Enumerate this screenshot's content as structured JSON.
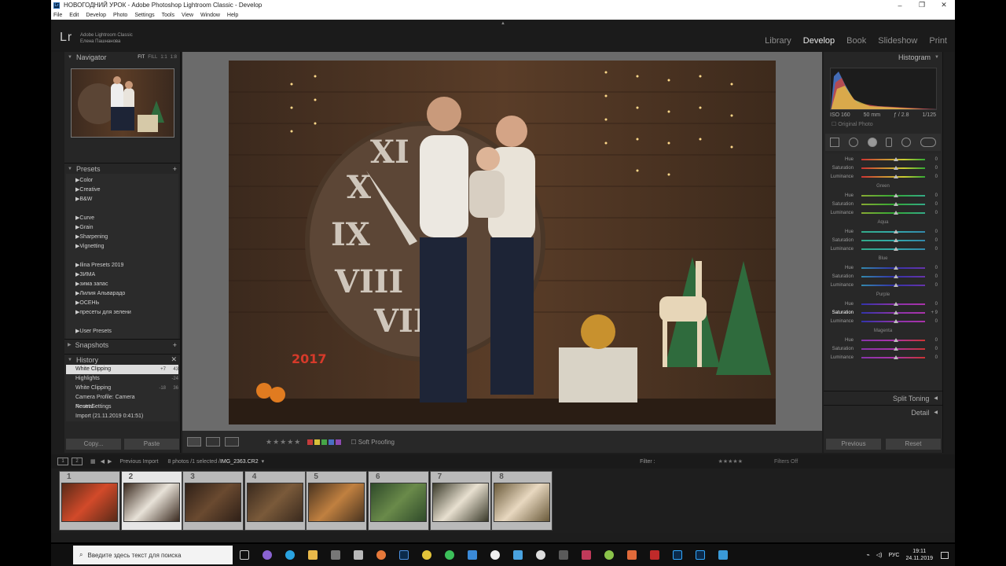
{
  "window": {
    "title": "НОВОГОДНИЙ УРОК - Adobe Photoshop Lightroom Classic - Develop",
    "lr_badge": "Lr"
  },
  "menu": [
    "File",
    "Edit",
    "Develop",
    "Photo",
    "Settings",
    "Tools",
    "View",
    "Window",
    "Help"
  ],
  "identity": {
    "logo": "Lr",
    "app": "Adobe Lightroom Classic",
    "user": "Елена Пашнанова"
  },
  "modules": [
    "Library",
    "Develop",
    "Book",
    "Slideshow",
    "Print"
  ],
  "active_module": "Develop",
  "navigator": {
    "label": "Navigator",
    "zoom": [
      "FIT",
      "FILL",
      "1:1",
      "1:8"
    ]
  },
  "presets": {
    "label": "Presets",
    "groups": [
      [
        "Color",
        "Creative",
        "B&W"
      ],
      [
        "Curve",
        "Grain",
        "Sharpening",
        "Vignetting"
      ],
      [
        "Ilina Presets 2019",
        "ЗИМА",
        "зима запас",
        "Лилия Альварадо",
        "ОСЕНЬ",
        "пресеты для зелени"
      ],
      [
        "User Presets"
      ]
    ]
  },
  "snapshots": {
    "label": "Snapshots"
  },
  "history": {
    "label": "History",
    "items": [
      {
        "name": "White Clipping",
        "a": "+7",
        "b": "43",
        "selected": true
      },
      {
        "name": "Highlights",
        "a": "",
        "b": "-24",
        "selected": false
      },
      {
        "name": "White Clipping",
        "a": "-18",
        "b": "36",
        "selected": false
      },
      {
        "name": "Camera Profile: Camera Neutral",
        "a": "",
        "b": "",
        "selected": false
      },
      {
        "name": "Reset Settings",
        "a": "",
        "b": "",
        "selected": false
      },
      {
        "name": "Import (21.11.2019 0:41:51)",
        "a": "",
        "b": "",
        "selected": false
      }
    ]
  },
  "left_buttons": {
    "copy": "Copy...",
    "paste": "Paste"
  },
  "toolbar": {
    "soft_proofing": "Soft Proofing",
    "stars": "★★★★★"
  },
  "swatch_colors": [
    "#c43b3b",
    "#d8c13a",
    "#46a547",
    "#4a6fc3",
    "#8e4ab2"
  ],
  "histogram": {
    "label": "Histogram",
    "iso": "ISO 160",
    "focal": "50 mm",
    "aperture": "ƒ / 2.8",
    "shutter": "1/125",
    "original": "Original Photo"
  },
  "hsl": [
    {
      "group": "",
      "rows": [
        {
          "label": "Hue",
          "value": "0"
        },
        {
          "label": "Saturation",
          "value": "0"
        },
        {
          "label": "Luminance",
          "value": "0"
        }
      ]
    },
    {
      "group": "Green",
      "rows": [
        {
          "label": "Hue",
          "value": "0"
        },
        {
          "label": "Saturation",
          "value": "0"
        },
        {
          "label": "Luminance",
          "value": "0"
        }
      ]
    },
    {
      "group": "Aqua",
      "rows": [
        {
          "label": "Hue",
          "value": "0"
        },
        {
          "label": "Saturation",
          "value": "0"
        },
        {
          "label": "Luminance",
          "value": "0"
        }
      ]
    },
    {
      "group": "Blue",
      "rows": [
        {
          "label": "Hue",
          "value": "0"
        },
        {
          "label": "Saturation",
          "value": "0"
        },
        {
          "label": "Luminance",
          "value": "0"
        }
      ]
    },
    {
      "group": "Purple",
      "rows": [
        {
          "label": "Hue",
          "value": "0"
        },
        {
          "label": "Saturation",
          "value": "+ 9"
        },
        {
          "label": "Luminance",
          "value": "0"
        }
      ]
    },
    {
      "group": "Magenta",
      "rows": [
        {
          "label": "Hue",
          "value": "0"
        },
        {
          "label": "Saturation",
          "value": "0"
        },
        {
          "label": "Luminance",
          "value": "0"
        }
      ]
    }
  ],
  "sections": {
    "split_toning": "Split Toning",
    "detail": "Detail"
  },
  "right_buttons": {
    "previous": "Previous",
    "reset": "Reset"
  },
  "filmstrip": {
    "screens": [
      "1",
      "2"
    ],
    "source": "Previous Import",
    "info": "8 photos /1 selected /",
    "filename": "IMG_2363.CR2",
    "filter_label": "Filter :",
    "filter_value": "Filters Off",
    "thumbs": [
      "1",
      "2",
      "3",
      "4",
      "5",
      "6",
      "7",
      "8"
    ],
    "selected": "2"
  },
  "taskbar": {
    "search_placeholder": "Введите здесь текст для поиска",
    "lang": "РУС",
    "time": "19:11",
    "date": "24.11.2019"
  }
}
